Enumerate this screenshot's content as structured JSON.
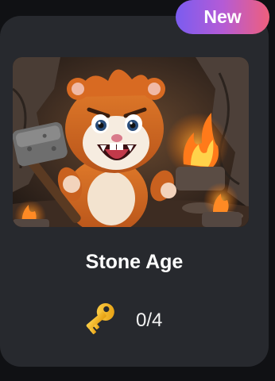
{
  "badge": {
    "label": "New"
  },
  "card": {
    "title": "Stone Age",
    "image_icon": "hamster-caveman-illustration",
    "progress": {
      "icon": "key-icon",
      "text": "0/4"
    }
  },
  "colors": {
    "card_background": "#27292e",
    "page_background": "#101114",
    "badge_gradient": [
      "#7b5cf0",
      "#ef5f7c"
    ],
    "key": "#f5b516"
  }
}
